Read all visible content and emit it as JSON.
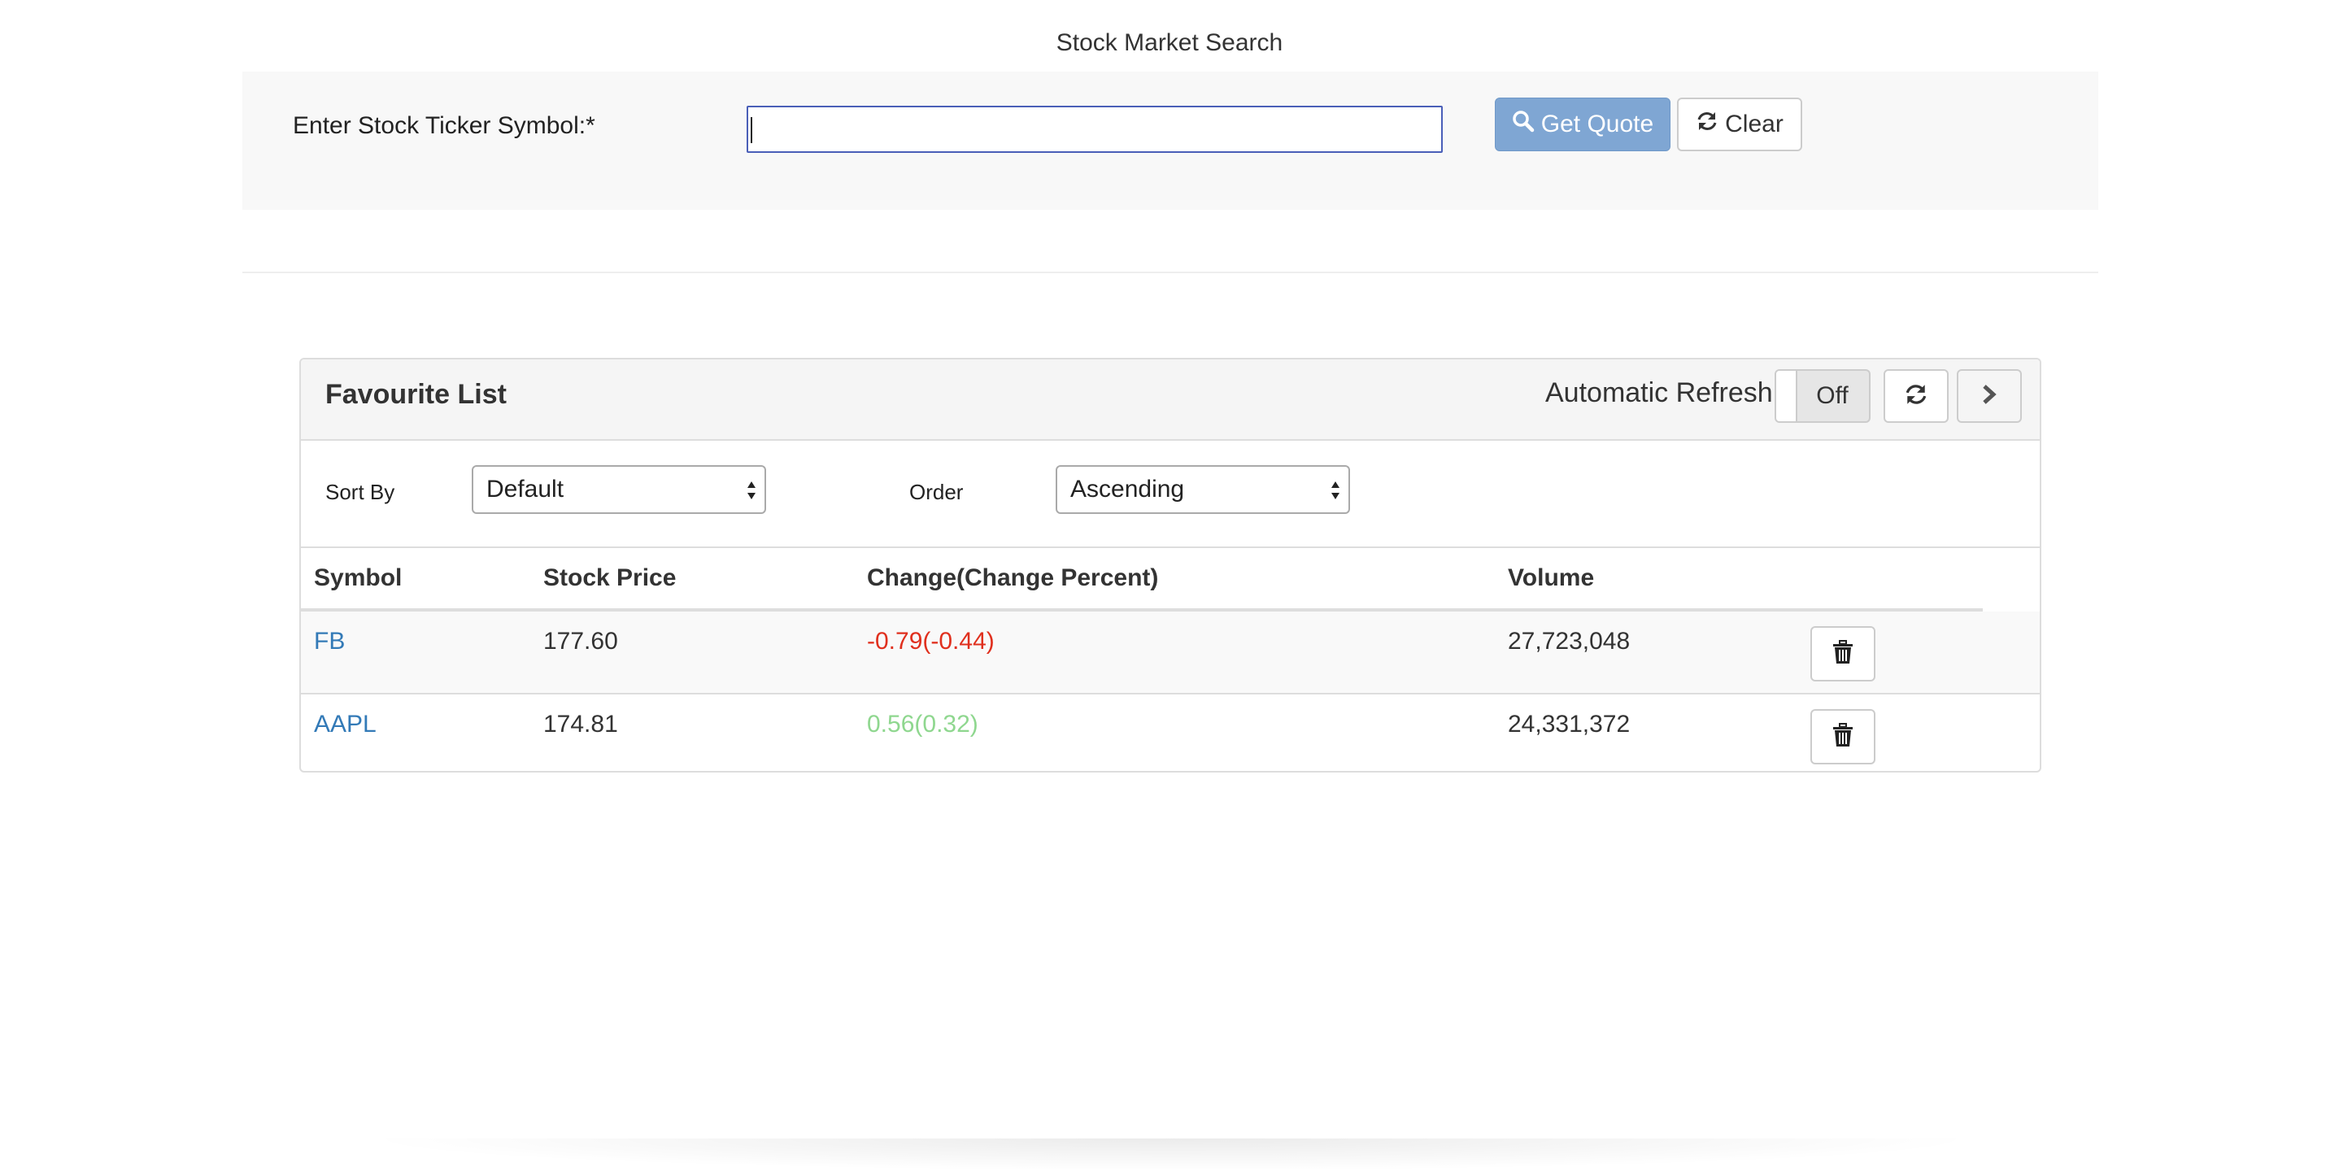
{
  "page": {
    "title": "Stock Market Search"
  },
  "search": {
    "label": "Enter Stock Ticker Symbol:*",
    "value": "",
    "placeholder": "",
    "get_quote_label": "Get Quote",
    "get_quote_icon": "search-icon",
    "clear_label": "Clear",
    "clear_icon": "refresh-icon"
  },
  "favourites": {
    "title": "Favourite List",
    "auto_refresh_label": "Automatic Refresh:",
    "auto_refresh_state": "Off",
    "sort_by_label": "Sort By",
    "sort_by_value": "Default",
    "order_label": "Order",
    "order_value": "Ascending",
    "columns": [
      "Symbol",
      "Stock Price",
      "Change(Change Percent)",
      "Volume"
    ],
    "rows": [
      {
        "symbol": "FB",
        "price": "177.60",
        "change": "-0.79(-0.44)",
        "direction": "negative",
        "volume": "27,723,048"
      },
      {
        "symbol": "AAPL",
        "price": "174.81",
        "change": "0.56(0.32)",
        "direction": "positive",
        "volume": "24,331,372"
      }
    ]
  },
  "colors": {
    "link": "#337ab7",
    "negative": "#e0301e",
    "positive": "#8fd78f",
    "primary_button": "#7fa6d3"
  }
}
